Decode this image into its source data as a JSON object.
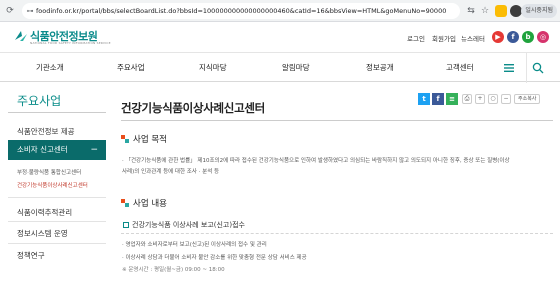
{
  "browser": {
    "url": "foodinfo.or.kr/portal/bbs/selectBoardList.do?bbsId=100000000000000000460&catId=16&bbsView=HTML&goMenuNo=900000...",
    "paused_label": "일시중지됨"
  },
  "header": {
    "logo_text": "식품안전정보원",
    "logo_sub": "NATIONAL FOOD SAFETY INFORMATION SERVICE",
    "util_links": [
      "로그인",
      "회원가입",
      "뉴스레터"
    ],
    "sns": [
      {
        "name": "youtube",
        "glyph": "▶",
        "color": "#e53935"
      },
      {
        "name": "facebook",
        "glyph": "f",
        "color": "#3b5998"
      },
      {
        "name": "blog",
        "glyph": "b",
        "color": "#20a33d"
      },
      {
        "name": "instagram",
        "glyph": "◎",
        "color": "#d6336c"
      }
    ]
  },
  "gnb": {
    "items": [
      "기관소개",
      "주요사업",
      "지식마당",
      "알림마당",
      "정보공개",
      "고객센터"
    ]
  },
  "sidebar": {
    "title": "주요사업",
    "items": [
      "식품안전정보 제공",
      "소비자 신고센터",
      "식품이력추적관리",
      "정보시스템 운영",
      "정책연구"
    ],
    "active_toggle": "−",
    "sub_items": [
      "부정·불량식품 통합신고센터",
      "건강기능식품이상사례신고센터"
    ]
  },
  "content": {
    "page_title": "건강기능식품이상사례신고센터",
    "share": [
      {
        "name": "twitter",
        "glyph": "t",
        "color": "#1da1f2"
      },
      {
        "name": "facebook",
        "glyph": "f",
        "color": "#3b5998"
      },
      {
        "name": "naver-band",
        "glyph": "≡",
        "color": "#35b15a"
      }
    ],
    "add_favorite": "주소복사",
    "section1_title": "사업 목적",
    "section1_line1": "· 「건강기능식품에 관한 법률」 제10조의2에 따라 접수된 건강기능식품으로 인하여 발생하였다고 의심되는 바람직하지 않고 의도되지 아니한 징후, 증상 또는 질병(이상",
    "section1_line2": "사례)의 인과관계 등에 대한 조사 · 분석 등",
    "section2_title": "사업 내용",
    "section2_item": "건강기능식품 이상사례 보고(신고)접수",
    "section2_line1": "· 영업자와 소비자로부터 보고(신고)된 이상사례의 접수 및 관리",
    "section2_line2": "· 이상사례 상담과 더불어 소비자 불안 감소를 위한 맞춤형 전문 상담 서비스 제공",
    "section2_line3": "※ 운영시간 : 평일(월~금) 09:00 ~ 18:00"
  }
}
